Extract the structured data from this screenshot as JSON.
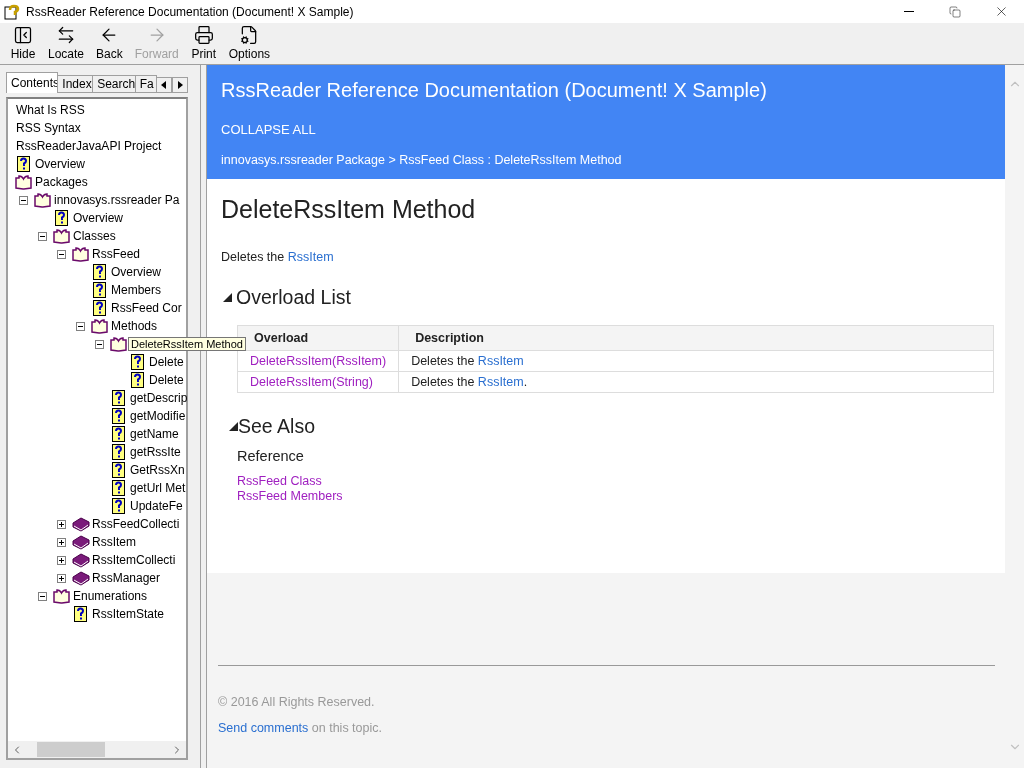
{
  "window": {
    "title": "RssReader Reference Documentation (Document! X Sample)"
  },
  "toolbar": [
    {
      "label": "Hide",
      "kind": "hide",
      "disabled": false
    },
    {
      "label": "Locate",
      "kind": "locate",
      "disabled": false
    },
    {
      "label": "Back",
      "kind": "back",
      "disabled": false
    },
    {
      "label": "Forward",
      "kind": "forward",
      "disabled": true
    },
    {
      "label": "Print",
      "kind": "print",
      "disabled": false
    },
    {
      "label": "Options",
      "kind": "options",
      "disabled": false
    }
  ],
  "nav_tabs": [
    {
      "label": "Contents",
      "selected": true
    },
    {
      "label": "Index",
      "selected": false
    },
    {
      "label": "Search",
      "selected": false
    },
    {
      "label": "Fa",
      "selected": false
    }
  ],
  "tree": [
    {
      "label": "What Is RSS",
      "kind": "text"
    },
    {
      "label": "RSS Syntax",
      "kind": "text"
    },
    {
      "label": "RssReaderJavaAPI Project",
      "kind": "text"
    },
    {
      "label": "Overview",
      "kind": "page"
    },
    {
      "label": "Packages",
      "kind": "book",
      "expanded": true,
      "children": [
        {
          "label": "innovasys.rssreader Pa",
          "kind": "book",
          "expanded": true,
          "children": [
            {
              "label": "Overview",
              "kind": "page"
            },
            {
              "label": "Classes",
              "kind": "book",
              "expanded": true,
              "children": [
                {
                  "label": "RssFeed",
                  "kind": "book",
                  "expanded": true,
                  "children": [
                    {
                      "label": "Overview",
                      "kind": "page"
                    },
                    {
                      "label": "Members",
                      "kind": "page"
                    },
                    {
                      "label": "RssFeed Cor",
                      "kind": "page"
                    },
                    {
                      "label": "Methods",
                      "kind": "book",
                      "expanded": true,
                      "children": [
                        {
                          "tooltip": "DeleteRssItem Method",
                          "kind": "book",
                          "expanded": true,
                          "children": [
                            {
                              "label": "Delete",
                              "kind": "page"
                            },
                            {
                              "label": "Delete",
                              "kind": "page"
                            }
                          ]
                        },
                        {
                          "label": "getDescrip",
                          "kind": "page"
                        },
                        {
                          "label": "getModifie",
                          "kind": "page"
                        },
                        {
                          "label": "getName",
                          "kind": "page"
                        },
                        {
                          "label": "getRssIte",
                          "kind": "page"
                        },
                        {
                          "label": "GetRssXn",
                          "kind": "page"
                        },
                        {
                          "label": "getUrl Met",
                          "kind": "page"
                        },
                        {
                          "label": "UpdateFe",
                          "kind": "page"
                        }
                      ]
                    }
                  ]
                },
                {
                  "label": "RssFeedCollecti",
                  "kind": "book",
                  "expanded": false
                },
                {
                  "label": "RssItem",
                  "kind": "book",
                  "expanded": false
                },
                {
                  "label": "RssItemCollecti",
                  "kind": "book",
                  "expanded": false
                },
                {
                  "label": "RssManager",
                  "kind": "book",
                  "expanded": false
                }
              ]
            },
            {
              "label": "Enumerations",
              "kind": "book",
              "expanded": true,
              "children": [
                {
                  "label": "RssItemState",
                  "kind": "page"
                }
              ]
            }
          ]
        }
      ]
    }
  ],
  "header": {
    "title": "RssReader Reference Documentation (Document! X Sample)",
    "collapse_all": "COLLAPSE ALL",
    "breadcrumb": "innovasys.rssreader Package > RssFeed Class : DeleteRssItem Method"
  },
  "page": {
    "title": "DeleteRssItem Method",
    "summary_prefix": "Deletes the ",
    "summary_link": "RssItem",
    "overload_heading": "Overload List",
    "overload_table": {
      "columns": [
        "Overload",
        "Description"
      ],
      "rows": [
        {
          "overload": "DeleteRssItem(RssItem)",
          "description_prefix": "Deletes the ",
          "description_link": "RssItem"
        },
        {
          "overload": "DeleteRssItem(String)",
          "description_prefix": "Deletes the ",
          "description_link": "RssItem",
          "description_suffix": "."
        }
      ]
    },
    "see_also_heading": "See Also",
    "reference_heading": "Reference",
    "reference_links": [
      "RssFeed Class",
      "RssFeed Members"
    ]
  },
  "footer": {
    "copyright": "© 2016 All Rights Reserved.",
    "comment_link": "Send comments",
    "comment_text": " on this topic."
  }
}
